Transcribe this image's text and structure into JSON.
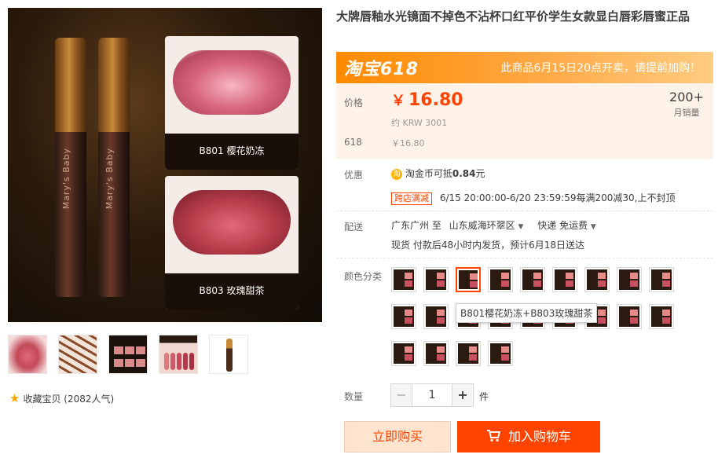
{
  "gallery": {
    "brand_text": "Mary's Baby",
    "swatch1_label": "B801 樱花奶冻",
    "swatch2_label": "B803 玫瑰甜茶",
    "favorite_text": "收藏宝贝 (2082人气)"
  },
  "product": {
    "title": "大牌唇釉水光镜面不掉色不沾杯口红平价学生女款显白唇彩唇蜜正品"
  },
  "promo": {
    "logo": "淘宝618",
    "notice": "此商品6月15日20点开卖，请提前加购！"
  },
  "price": {
    "label": "价格",
    "currency": "￥",
    "value": "16.80",
    "krw": "约 KRW 3001",
    "orig_label": "618",
    "orig_value": "￥16.80",
    "sales_num": "200+",
    "sales_unit": "月销量"
  },
  "discount": {
    "label": "优惠",
    "coin_icon": "淘",
    "coin_text": "淘金币可抵",
    "coin_value": "0.84",
    "coin_unit": "元",
    "tag": "跨店满减",
    "rule": "6/15 20:00:00-6/20 23:59:59每满200减30,上不封顶"
  },
  "shipping": {
    "label": "配送",
    "from": "广东广州 至",
    "to": "山东威海环翠区",
    "method": "快递 免运费",
    "note": "现货 付款后48小时内发货，预计6月18日送达"
  },
  "sku": {
    "label": "颜色分类",
    "tooltip": "B801樱花奶冻+B803玫瑰甜茶",
    "count": 22,
    "selected_index": 2
  },
  "quantity": {
    "label": "数量",
    "minus": "−",
    "value": "1",
    "plus": "+",
    "unit": "件"
  },
  "actions": {
    "buy_now": "立即购买",
    "add_to_cart": "加入购物车"
  },
  "colors": {
    "accent": "#ff4400",
    "promo_orange": "#ff8a00",
    "price_bg": "#fff2e8"
  }
}
